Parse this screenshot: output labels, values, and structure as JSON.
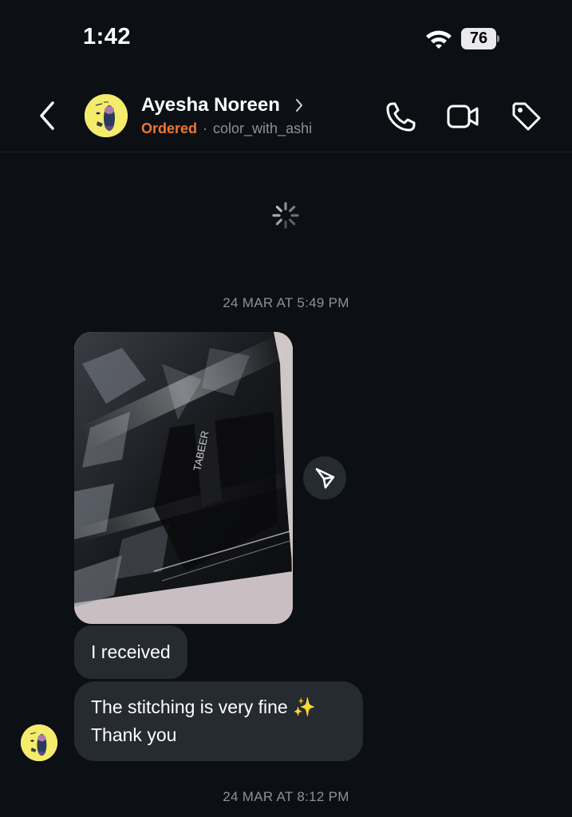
{
  "status_bar": {
    "time": "1:42",
    "battery": "76"
  },
  "header": {
    "name": "Ayesha Noreen",
    "status": "Ordered",
    "separator": "·",
    "username": "color_with_ashi"
  },
  "icons": {
    "back": "chevron-left-icon",
    "phone": "phone-icon",
    "video": "video-camera-icon",
    "tag": "tag-icon",
    "share": "send-icon",
    "loading": "spinner-icon"
  },
  "messages": {
    "timestamp_1": "24 MAR AT 5:49 PM",
    "bubble_1": "I received",
    "bubble_2_line_1": "The stitching is very fine ✨",
    "bubble_2_line_2": "Thank you",
    "timestamp_2": "24 MAR AT 8:12 PM"
  },
  "colors": {
    "background": "#0c0f14",
    "bubble": "#262a31",
    "ordered": "#f0782a",
    "muted": "#8c919a"
  }
}
